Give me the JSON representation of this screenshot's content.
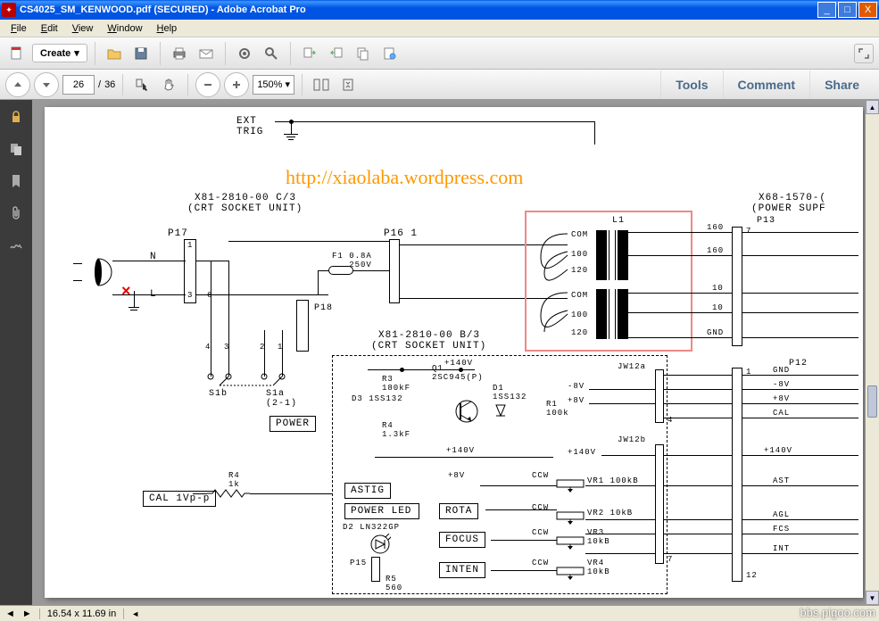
{
  "window": {
    "title": "CS4025_SM_KENWOOD.pdf (SECURED) - Adobe Acrobat Pro",
    "min": "_",
    "max": "□",
    "close": "X"
  },
  "menu": {
    "file": "File",
    "edit": "Edit",
    "view": "View",
    "window": "Window",
    "help": "Help"
  },
  "toolbar": {
    "create": "Create",
    "create_drop": "▾",
    "page_current": "26",
    "page_sep": "/",
    "page_total": "36",
    "zoom": "150%",
    "zoom_drop": "▾"
  },
  "links": {
    "tools": "Tools",
    "comment": "Comment",
    "share": "Share"
  },
  "status": {
    "dimensions": "16.54 x 11.69 in",
    "left_arrow": "◄",
    "right_arrow": "►"
  },
  "watermark_url": "http://xiaolaba.wordpress.com",
  "watermark_corner": "bbs.pigoo.com",
  "schematic": {
    "ext_trig": "EXT\nTRIG",
    "sock_c_part": "X81-2810-00 C/3",
    "sock_c_name": "(CRT SOCKET UNIT)",
    "sock_b_part": "X81-2810-00 B/3",
    "sock_b_name": "(CRT SOCKET UNIT)",
    "psu_part": "X68-1570-(",
    "psu_name": "(POWER SUPF",
    "p17": "P17",
    "p16": "P16 1",
    "p18": "P18",
    "p13": "P13",
    "p12": "P12",
    "p15": "P15",
    "n": "N",
    "l": "L",
    "f1": "F1 0.8A\n   250V",
    "l1": "L1",
    "com": "COM",
    "v100": "100",
    "v120": "120",
    "v160": "160",
    "v10": "10",
    "gnd": "GND",
    "s1b": "S1b",
    "s1a": "S1a\n(2-1)",
    "power_btn": "POWER",
    "cal_box": "CAL\n1Vp-p",
    "power_led": "POWER LED",
    "astig": "ASTIG",
    "rota": "ROTA",
    "focus": "FOCUS",
    "inten": "INTEN",
    "r3": "R3\n180kF",
    "r4": "R4\n1.3kF",
    "r4b": "R4\n1k",
    "r5": "R5\n560",
    "r1": "R1\n100k",
    "q1": "Q1\n2SC945(P)",
    "d1": "D1\n1SS132",
    "d3": "D3 1SS132",
    "d2": "D2 LN322GP",
    "v140": "+140V",
    "m8v": "-8V",
    "p8v": "+8V",
    "cal": "CAL",
    "jw12a": "JW12a",
    "jw12b": "JW12b",
    "ccw": "CCW",
    "vr1": "VR1 100kB",
    "vr2": "VR2 10kB",
    "vr3": "VR3\n10kB",
    "vr4": "VR4\n10kB",
    "ast": "AST",
    "agl": "AGL",
    "fcs": "FCS",
    "int": "INT",
    "pins": {
      "p1": "1",
      "p3": "3",
      "p4": "4",
      "p2": "2",
      "p6": "6",
      "p7": "7",
      "p12n": "12"
    }
  }
}
